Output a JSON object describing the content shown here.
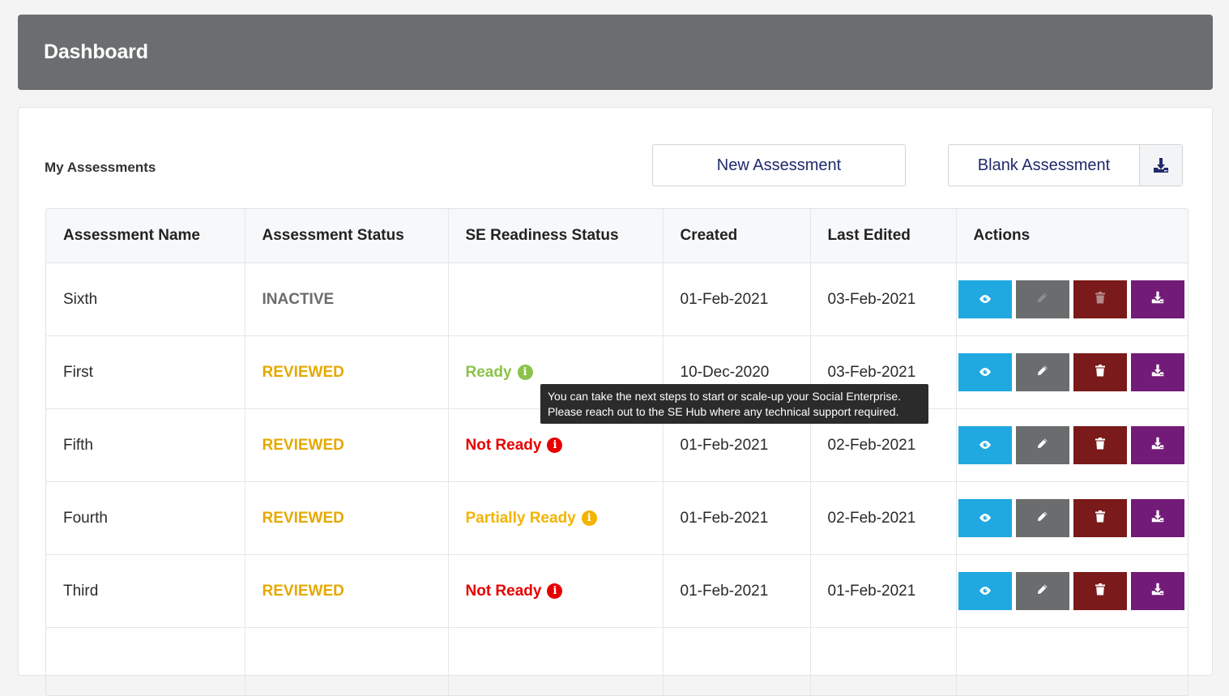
{
  "header": {
    "title": "Dashboard"
  },
  "section": {
    "title": "My Assessments",
    "new_button": "New Assessment",
    "blank_button": "Blank Assessment",
    "blank_icon": "download-icon"
  },
  "table": {
    "columns": [
      "Assessment Name",
      "Assessment Status",
      "SE Readiness Status",
      "Created",
      "Last Edited",
      "Actions"
    ],
    "rows": [
      {
        "name": "Sixth",
        "status": "INACTIVE",
        "readiness": "",
        "created": "01-Feb-2021",
        "edited": "03-Feb-2021"
      },
      {
        "name": "First",
        "status": "REVIEWED",
        "readiness": "Ready",
        "created": "10-Dec-2020",
        "edited": "03-Feb-2021"
      },
      {
        "name": "Fifth",
        "status": "REVIEWED",
        "readiness": "Not Ready",
        "created": "01-Feb-2021",
        "edited": "02-Feb-2021"
      },
      {
        "name": "Fourth",
        "status": "REVIEWED",
        "readiness": "Partially Ready",
        "created": "01-Feb-2021",
        "edited": "02-Feb-2021"
      },
      {
        "name": "Third",
        "status": "REVIEWED",
        "readiness": "Not Ready",
        "created": "01-Feb-2021",
        "edited": "01-Feb-2021"
      }
    ]
  },
  "tooltip": {
    "line1": "You can take the next steps to start or scale-up your Social Enterprise.",
    "line2": "Please reach out to the SE Hub where any technical support required."
  },
  "colors": {
    "header_bg": "#6b6e6f",
    "view": "#20a8e0",
    "edit": "#6a6c6d",
    "delete": "#7a1a1a",
    "download": "#731b78",
    "reviewed": "#e6a800",
    "ready": "#8bc34a",
    "not_ready": "#e60000",
    "partial": "#f2b400"
  }
}
